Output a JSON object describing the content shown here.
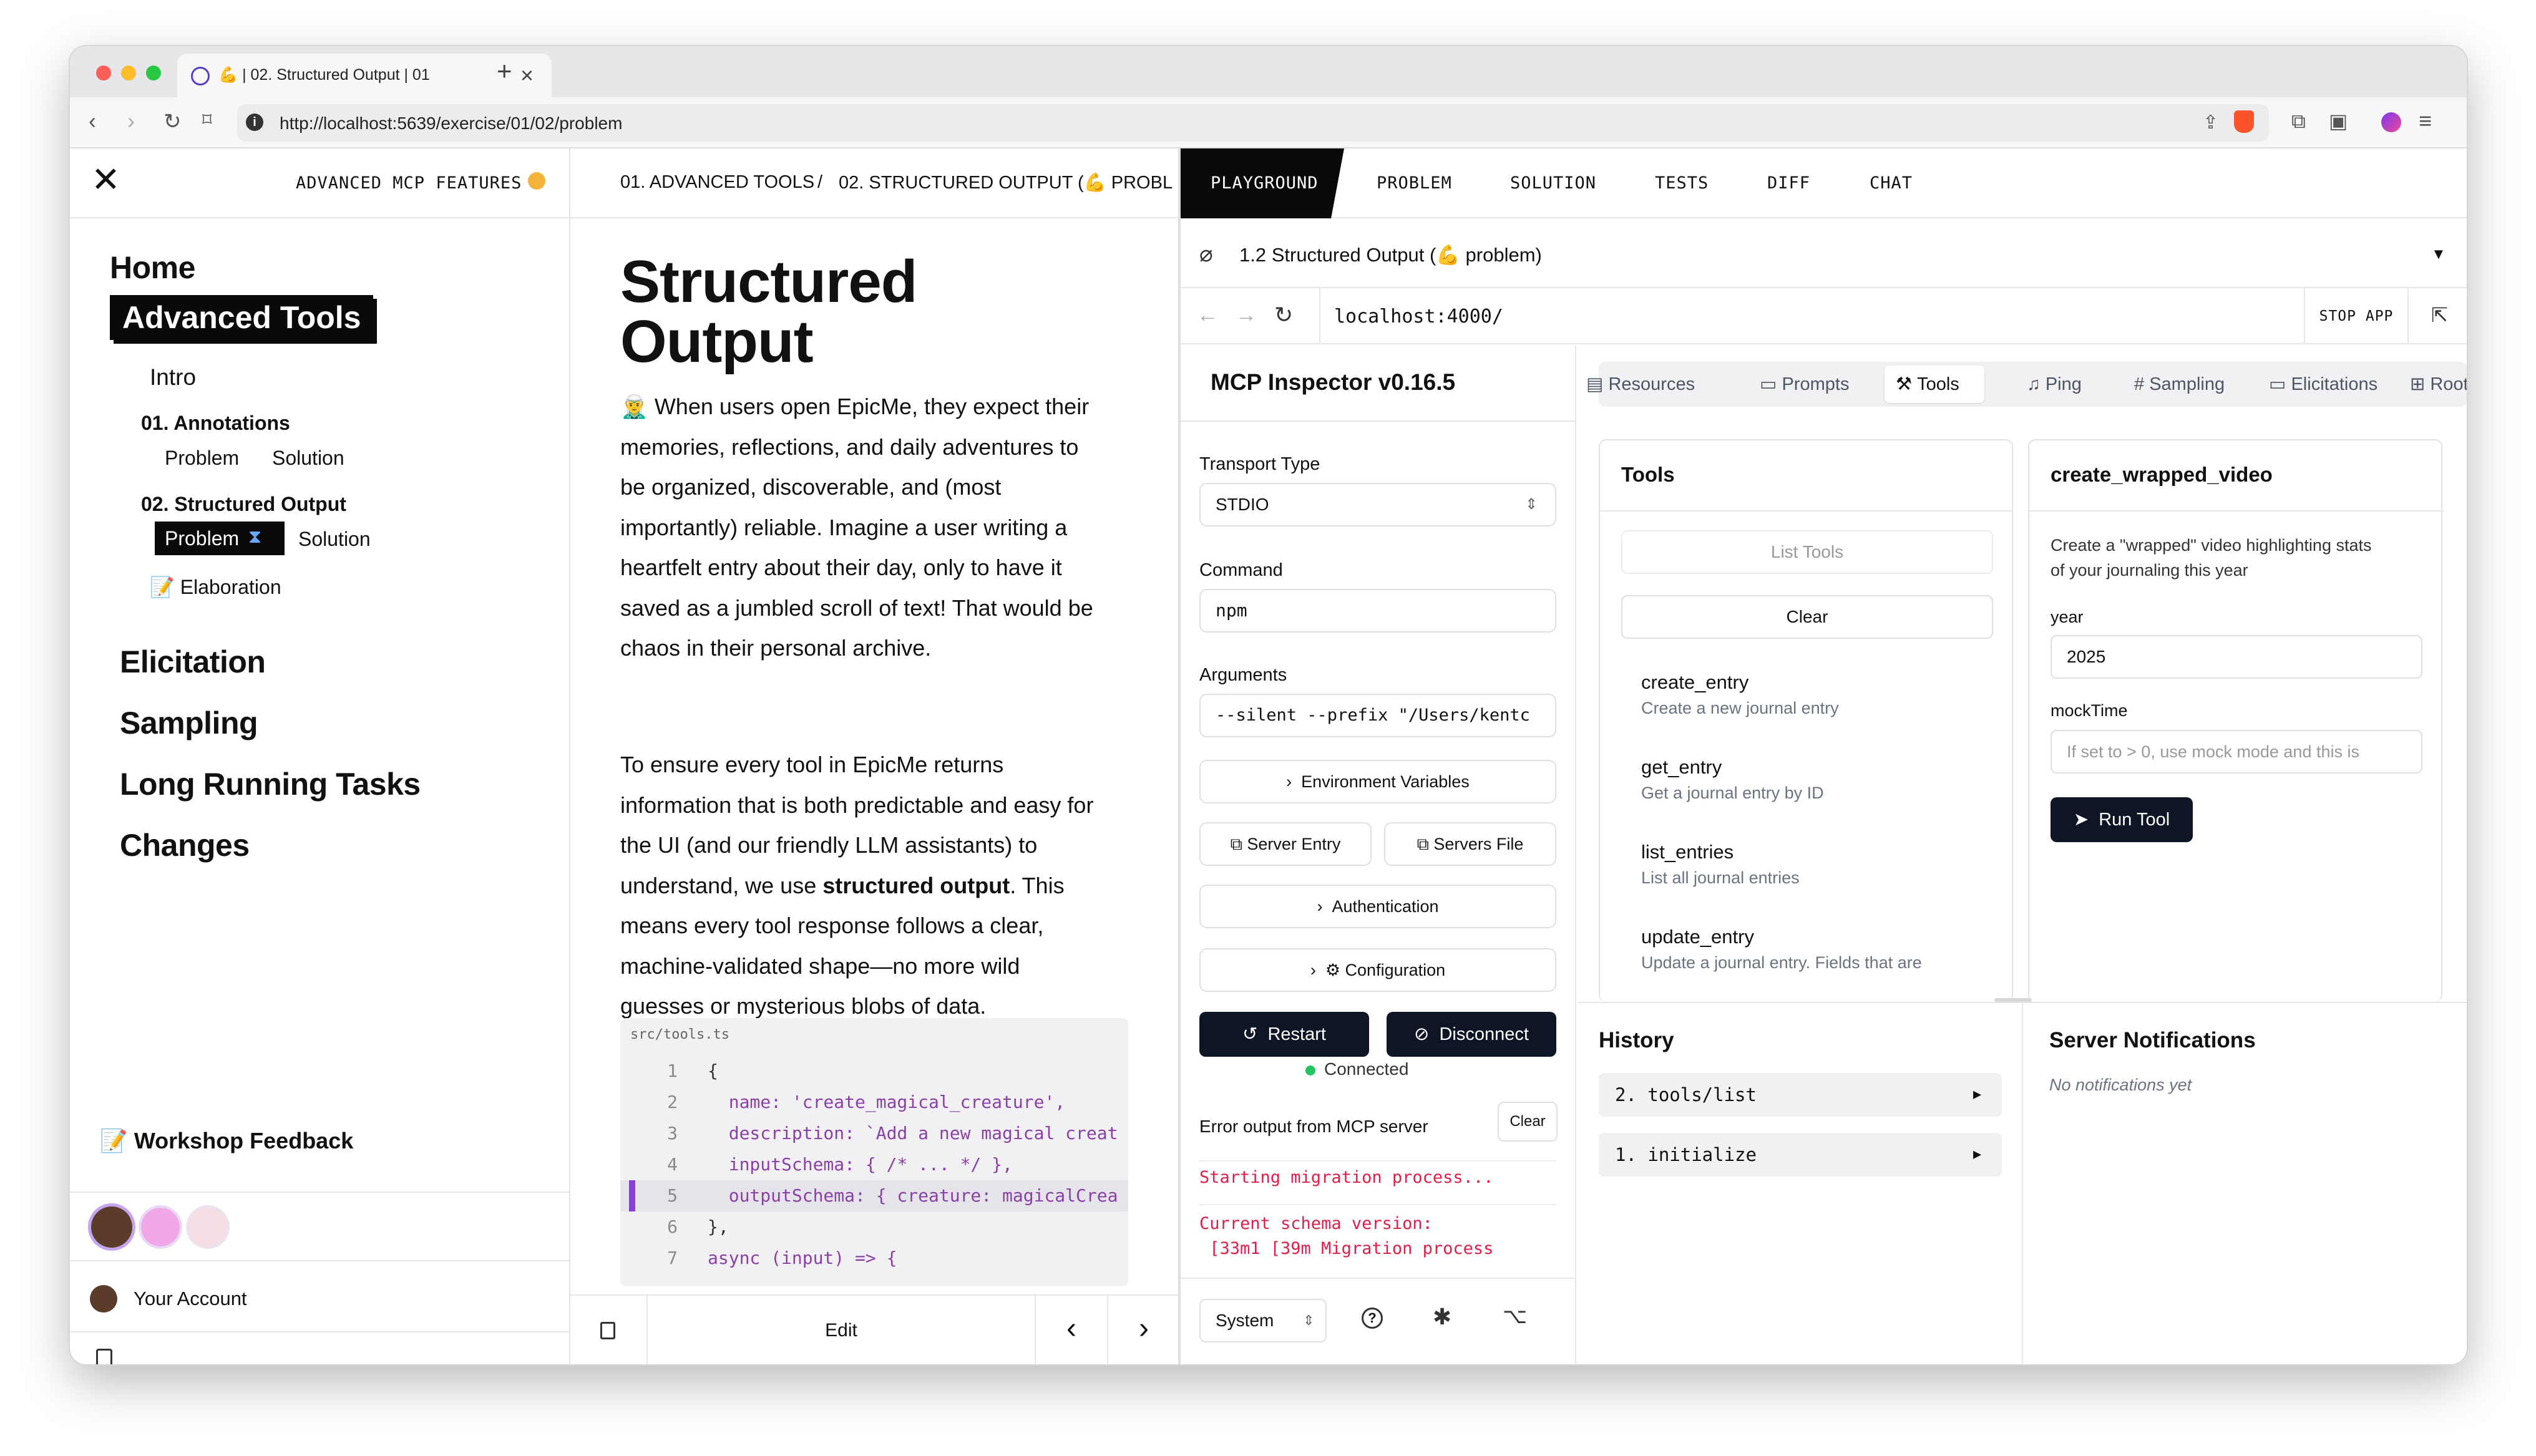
{
  "browser": {
    "tab_title": "💪 | 02. Structured Output | 01",
    "url": "http://localhost:5639/exercise/01/02/problem",
    "new_tab": "+",
    "tab_close": "×"
  },
  "sidebar": {
    "workshop_title": "ADVANCED MCP FEATURES",
    "nav": {
      "home": "Home",
      "advanced_tools": "Advanced Tools",
      "intro": "Intro",
      "annotations": "01. Annotations",
      "annotations_problem": "Problem",
      "annotations_solution": "Solution",
      "structured_output": "02. Structured Output",
      "so_problem": "Problem",
      "so_solution": "Solution",
      "elaboration": "📝 Elaboration",
      "elicitation": "Elicitation",
      "sampling": "Sampling",
      "long_running": "Long Running Tasks",
      "changes": "Changes"
    },
    "feedback": "📝 Workshop Feedback",
    "account": "Your Account"
  },
  "article": {
    "breadcrumb_1": "01. ADVANCED TOOLS",
    "breadcrumb_sep": "/",
    "breadcrumb_2": "02. STRUCTURED OUTPUT (💪 PROBL",
    "title_line1": "Structured",
    "title_line2": "Output",
    "p1_lines": [
      "🧝‍♂️ When users open EpicMe, they expect their",
      "memories, reflections, and daily adventures to",
      "be organized, discoverable, and (most",
      "importantly) reliable. Imagine a user writing a",
      "heartfelt entry about their day, only to have it",
      "saved as a jumbled scroll of text! That would be",
      "chaos in their personal archive."
    ],
    "p2_l1": "To ensure every tool in EpicMe returns",
    "p2_l2": "information that is both predictable and easy for",
    "p2_l3": "the UI (and our friendly LLM assistants) to",
    "p2_l4a": "understand, we use ",
    "p2_l4b": "structured output",
    "p2_l4c": ". This",
    "p2_l5": "means every tool response follows a clear,",
    "p2_l6": "machine-validated shape—no more wild",
    "p2_l7": "guesses or mysterious blobs of data.",
    "code_file": "src/tools.ts",
    "code_lines": [
      {
        "n": "1",
        "t": "{"
      },
      {
        "n": "2",
        "t": "  name: 'create_magical_creature',"
      },
      {
        "n": "3",
        "t": "  description: `Add a new magical creat"
      },
      {
        "n": "4",
        "t": "  inputSchema: { /* ... */ },"
      },
      {
        "n": "5",
        "t": "  outputSchema: { creature: magicalCrea"
      },
      {
        "n": "6",
        "t": "},"
      },
      {
        "n": "7",
        "t": "async (input) => {"
      }
    ],
    "edit": "Edit"
  },
  "playground": {
    "tabs": [
      "PLAYGROUND",
      "PROBLEM",
      "SOLUTION",
      "TESTS",
      "DIFF",
      "CHAT"
    ],
    "app_select": "1.2 Structured Output (💪 problem)",
    "address": "localhost:4000/",
    "stop_app": "STOP APP"
  },
  "inspector": {
    "title": "MCP Inspector v0.16.5",
    "transport_label": "Transport Type",
    "transport_value": "STDIO",
    "command_label": "Command",
    "command_value": "npm",
    "args_label": "Arguments",
    "args_value": "--silent --prefix \"/Users/kentc",
    "env_vars": "Environment Variables",
    "server_entry": "Server Entry",
    "servers_file": "Servers File",
    "authentication": "Authentication",
    "configuration": "Configuration",
    "restart": "Restart",
    "disconnect": "Disconnect",
    "status": "Connected",
    "error_title": "Error output from MCP server",
    "clear": "Clear",
    "log_1": "Starting migration process...",
    "log_2": "Current schema version:",
    "log_3": " [33m1 [39m Migration process",
    "theme": "System"
  },
  "main": {
    "tabs": [
      "Resources",
      "Prompts",
      "Tools",
      "Ping",
      "Sampling",
      "Elicitations",
      "Roots"
    ],
    "tools_title": "Tools",
    "list_tools": "List Tools",
    "clear": "Clear",
    "tools": [
      {
        "name": "create_entry",
        "desc": "Create a new journal entry"
      },
      {
        "name": "get_entry",
        "desc": "Get a journal entry by ID"
      },
      {
        "name": "list_entries",
        "desc": "List all journal entries"
      },
      {
        "name": "update_entry",
        "desc": "Update a journal entry. Fields that are"
      }
    ],
    "detail_title": "create_wrapped_video",
    "detail_desc_1": "Create a \"wrapped\" video highlighting stats",
    "detail_desc_2": "of your journaling this year",
    "year_label": "year",
    "year_value": "2025",
    "mock_label": "mockTime",
    "mock_placeholder": "If set to > 0, use mock mode and this is",
    "run_tool": "Run Tool",
    "history_title": "History",
    "history": [
      "2. tools/list",
      "1. initialize"
    ],
    "notif_title": "Server Notifications",
    "notif_empty": "No notifications yet"
  },
  "colors": {
    "accent_dark": "#0e1525",
    "connected": "#22c55e",
    "code_highlight": "#8b3fd9",
    "log_red": "#e11d48"
  }
}
